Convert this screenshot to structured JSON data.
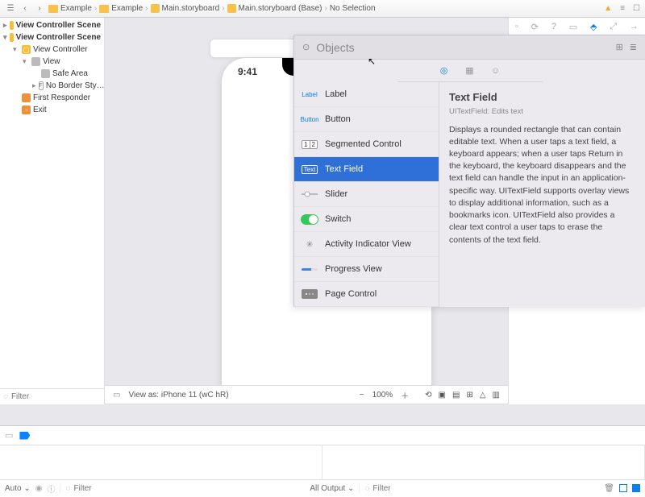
{
  "breadcrumb": {
    "items": [
      "Example",
      "Example",
      "Main.storyboard",
      "Main.storyboard (Base)",
      "No Selection"
    ]
  },
  "navigator": {
    "scene1": "View Controller Scene",
    "scene2": "View Controller Scene",
    "items": {
      "vc": "View Controller",
      "view": "View",
      "safe": "Safe Area",
      "noborder": "No Border Sty…",
      "responder": "First Responder",
      "exit": "Exit"
    },
    "filter_placeholder": "Filter"
  },
  "canvas": {
    "time": "9:41",
    "viewas": "View as: iPhone 11 (wC hR)",
    "zoom": "100%"
  },
  "library": {
    "title": "Objects",
    "items": {
      "label": "Label",
      "button": "Button",
      "segmented": "Segmented Control",
      "textfield": "Text Field",
      "slider": "Slider",
      "switch": "Switch",
      "activity": "Activity Indicator View",
      "progress": "Progress View",
      "pagecontrol": "Page Control"
    },
    "icon_tags": {
      "label": "Label",
      "button": "Button",
      "text": "Text",
      "seg1": "1",
      "seg2": "2"
    },
    "detail": {
      "title": "Text Field",
      "subtitle": "UITextField: Edits text",
      "body": "Displays a rounded rectangle that can contain editable text. When a user taps a text field, a keyboard appears; when a user taps Return in the keyboard, the keyboard disappears and the text field can handle the input in an application-specific way. UITextField supports overlay views to display additional information, such as a bookmarks icon. UITextField also provides a clear text control a user taps to erase the contents of the text field."
    }
  },
  "debug": {
    "auto": "Auto",
    "alloutput": "All Output",
    "filter_placeholder": "Filter"
  }
}
